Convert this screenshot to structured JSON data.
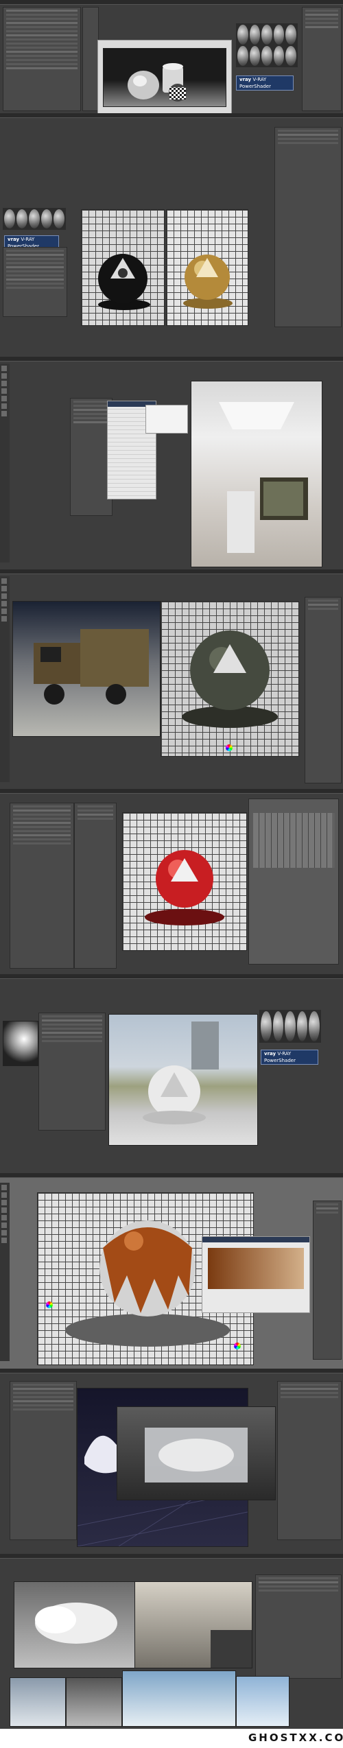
{
  "watermark": {
    "text": "GHOSTXX.COM"
  },
  "labels": {
    "vray_brand": "vray",
    "vray_product": "V-RAY PowerShader"
  },
  "colors": {
    "ui_dark": "#3d3d3d",
    "panel": "#4a4a4a",
    "vray_blue": "#1f3966",
    "red_material": "#c81e22",
    "caramel": "#a34b16",
    "sky_blue": "#8fb3d6"
  },
  "icons": [
    "vray-logo-icon",
    "color-wheel-icon",
    "material-sphere-icon"
  ]
}
